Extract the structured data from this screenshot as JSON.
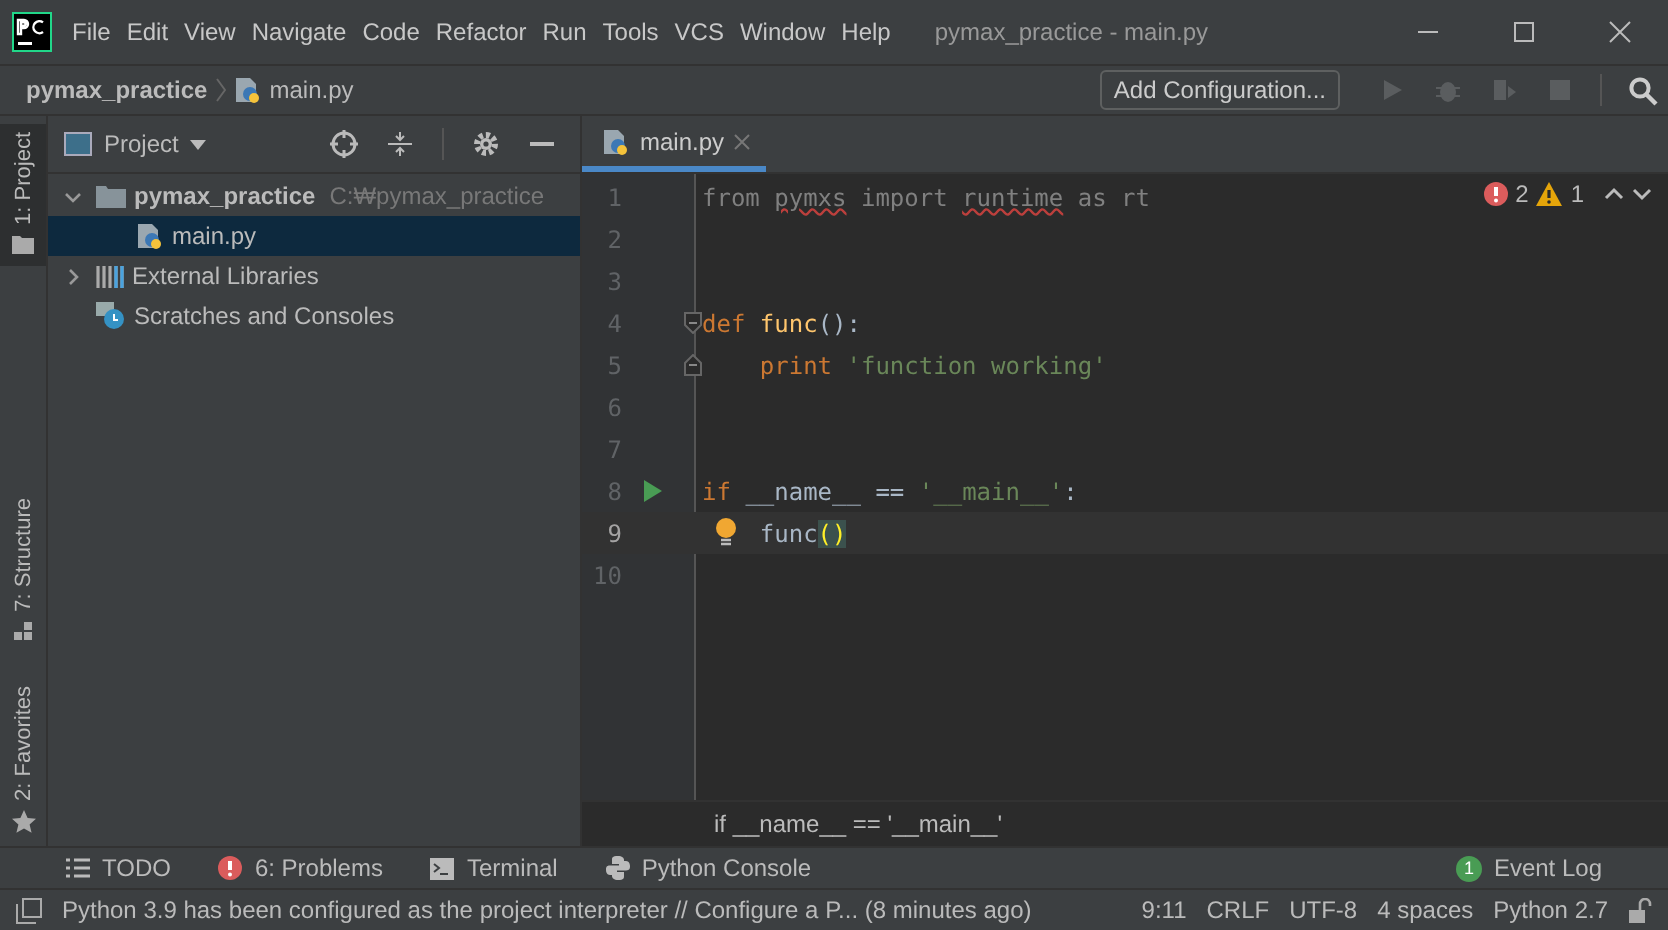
{
  "window": {
    "title": "pymax_practice - main.py"
  },
  "menu": [
    "File",
    "Edit",
    "View",
    "Navigate",
    "Code",
    "Refactor",
    "Run",
    "Tools",
    "VCS",
    "Window",
    "Help"
  ],
  "breadcrumbs": [
    "pymax_practice",
    "main.py"
  ],
  "toolbar": {
    "config_button": "Add Configuration..."
  },
  "side_tabs": [
    {
      "label": "1: Project",
      "kind": "project",
      "selected": true
    },
    {
      "label": "7: Structure",
      "kind": "structure",
      "selected": false
    },
    {
      "label": "2: Favorites",
      "kind": "favorites",
      "selected": false
    }
  ],
  "project": {
    "title": "Project",
    "tree": [
      {
        "label": "pymax_practice",
        "path": "C:₩pymax_practice",
        "kind": "folder",
        "expanded": true,
        "selected": false,
        "children": [
          {
            "label": "main.py",
            "kind": "python",
            "selected": true
          }
        ]
      },
      {
        "label": "External Libraries",
        "kind": "libraries",
        "expanded": false,
        "selected": false
      },
      {
        "label": "Scratches and Consoles",
        "kind": "scratches",
        "selected": false
      }
    ]
  },
  "editor": {
    "tabs": [
      {
        "label": "main.py",
        "selected": true
      }
    ],
    "errors": "2",
    "warnings": "1",
    "lines": [
      {
        "number": "1",
        "kind": "plain",
        "indented": false,
        "current": false,
        "tokens": [
          {
            "text": "from ",
            "kind": "dim"
          },
          {
            "text": "pymxs",
            "kind": "dim-error"
          },
          {
            "text": " import ",
            "kind": "dim"
          },
          {
            "text": "runtime",
            "kind": "dim-error"
          },
          {
            "text": " as rt",
            "kind": "dim"
          }
        ]
      },
      {
        "number": "2",
        "kind": "plain",
        "current": false
      },
      {
        "number": "3",
        "kind": "plain",
        "current": false
      },
      {
        "number": "4",
        "kind": "fold-start",
        "indented": false,
        "current": false,
        "tokens": [
          {
            "text": "def ",
            "kind": "keyword"
          },
          {
            "text": "func",
            "kind": "function"
          },
          {
            "text": "():",
            "kind": "plain"
          }
        ]
      },
      {
        "number": "5",
        "kind": "fold-end",
        "indented": true,
        "current": false,
        "tokens": [
          {
            "text": "print ",
            "kind": "keyword"
          },
          {
            "text": "'function working'",
            "kind": "string"
          }
        ]
      },
      {
        "number": "6",
        "kind": "plain",
        "current": false
      },
      {
        "number": "7",
        "kind": "plain",
        "current": false
      },
      {
        "number": "8",
        "kind": "run",
        "indented": false,
        "current": false,
        "tokens": [
          {
            "text": "if ",
            "kind": "keyword"
          },
          {
            "text": "__name__ == ",
            "kind": "plain"
          },
          {
            "text": "'__main__'",
            "kind": "string"
          },
          {
            "text": ":",
            "kind": "plain"
          }
        ]
      },
      {
        "number": "9",
        "kind": "bulb",
        "indented": true,
        "current": true,
        "tokens": [
          {
            "text": "func",
            "kind": "plain"
          },
          {
            "text": "()",
            "kind": "match"
          }
        ]
      },
      {
        "number": "10",
        "kind": "plain",
        "current": false
      }
    ],
    "breadcrumb": "if __name__ == '__main__'"
  },
  "tool_windows": [
    {
      "label": "TODO",
      "kind": "todo"
    },
    {
      "label": "6: Problems",
      "kind": "problems"
    },
    {
      "label": "Terminal",
      "kind": "terminal"
    },
    {
      "label": "Python Console",
      "kind": "console"
    }
  ],
  "event_log": {
    "label": "Event Log",
    "count": "1"
  },
  "status_bar": {
    "message": "Python 3.9 has been configured as the project interpreter // Configure a P... (8 minutes ago)",
    "items": [
      "9:11",
      "CRLF",
      "UTF-8",
      "4 spaces",
      "Python 2.7"
    ]
  }
}
